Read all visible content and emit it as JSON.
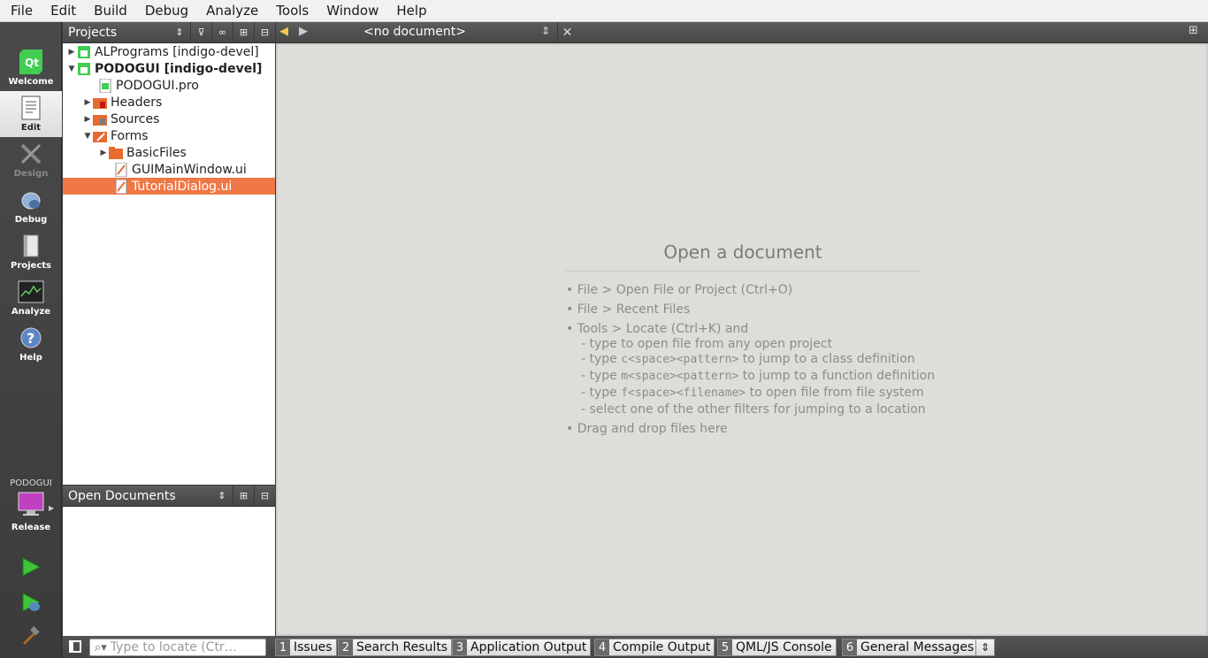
{
  "menu": {
    "items": [
      {
        "label": "File"
      },
      {
        "label": "Edit"
      },
      {
        "label": "Build"
      },
      {
        "label": "Debug"
      },
      {
        "label": "Analyze"
      },
      {
        "label": "Tools"
      },
      {
        "label": "Window"
      },
      {
        "label": "Help"
      }
    ]
  },
  "modes": {
    "welcome": "Welcome",
    "edit": "Edit",
    "design": "Design",
    "debug": "Debug",
    "projects": "Projects",
    "analyze": "Analyze",
    "help": "Help"
  },
  "kit": {
    "project": "PODOGUI",
    "build": "Release"
  },
  "projects_panel": {
    "title": "Projects",
    "tree": [
      {
        "label": "ALPrograms [indigo-devel]",
        "icon": "qt-project-icon"
      },
      {
        "label": "PODOGUI [indigo-devel]",
        "icon": "qt-project-icon"
      },
      {
        "label": "PODOGUI.pro",
        "icon": "pro-file-icon"
      },
      {
        "label": "Headers",
        "icon": "headers-folder-icon"
      },
      {
        "label": "Sources",
        "icon": "sources-folder-icon"
      },
      {
        "label": "Forms",
        "icon": "forms-folder-icon"
      },
      {
        "label": "BasicFiles",
        "icon": "folder-icon"
      },
      {
        "label": "GUIMainWindow.ui",
        "icon": "ui-file-icon"
      },
      {
        "label": "TutorialDialog.ui",
        "icon": "ui-file-icon"
      }
    ]
  },
  "open_documents_panel": {
    "title": "Open Documents"
  },
  "editor": {
    "document_selector": "<no document>",
    "placeholder": {
      "title": "Open a document",
      "hints": [
        "• File > Open File or Project (Ctrl+O)",
        "• File > Recent Files",
        "• Tools > Locate (Ctrl+K) and",
        "- type to open file from any open project",
        "- select one of the other filters for jumping to a location",
        "• Drag and drop files here"
      ],
      "locate_hints": [
        {
          "prefix": "- type ",
          "code": "c<space><pattern>",
          "suffix": " to jump to a class definition"
        },
        {
          "prefix": "- type ",
          "code": "m<space><pattern>",
          "suffix": " to jump to a function definition"
        },
        {
          "prefix": "- type ",
          "code": "f<space><filename>",
          "suffix": " to open file from file system"
        }
      ]
    }
  },
  "bottom_bar": {
    "locator_placeholder": "Type to locate (Ctr…",
    "output_panes": [
      {
        "num": "1",
        "label": "Issues"
      },
      {
        "num": "2",
        "label": "Search Results"
      },
      {
        "num": "3",
        "label": "Application Output"
      },
      {
        "num": "4",
        "label": "Compile Output"
      },
      {
        "num": "5",
        "label": "QML/JS Console"
      },
      {
        "num": "6",
        "label": "General Messages"
      }
    ]
  },
  "colors": {
    "selection": "#f07746",
    "editor_bg": "#dfddd9",
    "modebar_bg": "#3f3f3f"
  }
}
